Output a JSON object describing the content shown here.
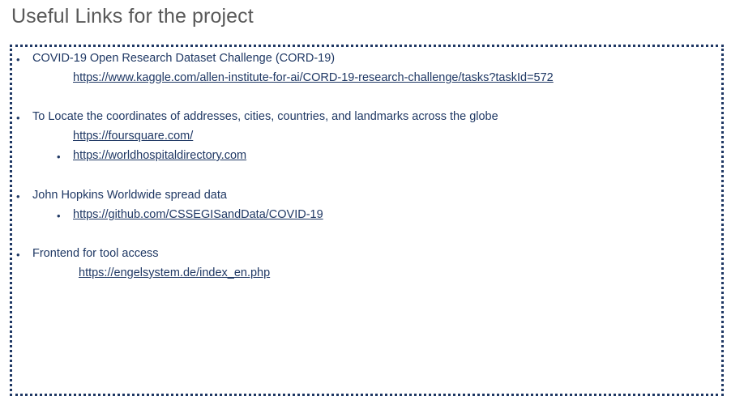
{
  "title": "Useful Links for the project",
  "sections": [
    {
      "heading": "COVID-19 Open Research Dataset Challenge (CORD-19)",
      "links": [
        {
          "text": "https://www.kaggle.com/allen-institute-for-ai/CORD-19-research-challenge/tasks?taskId=572",
          "bulleted": false
        }
      ]
    },
    {
      "heading": "To Locate the coordinates of addresses, cities, countries, and landmarks across the globe",
      "links": [
        {
          "text": "https://foursquare.com/",
          "bulleted": false
        },
        {
          "text": "https://worldhospitaldirectory.com",
          "bulleted": true
        }
      ]
    },
    {
      "heading": "John Hopkins Worldwide spread data",
      "links": [
        {
          "text": "https://github.com/CSSEGISandData/COVID-19",
          "bulleted": true
        }
      ]
    },
    {
      "heading": "Frontend for tool access",
      "links": [
        {
          "text": "https://engelsystem.de/index_en.php",
          "bulleted": false
        }
      ]
    }
  ],
  "bullet_glyph": "•",
  "colors": {
    "title": "#595959",
    "text": "#1f3864",
    "border": "#1f3864"
  }
}
